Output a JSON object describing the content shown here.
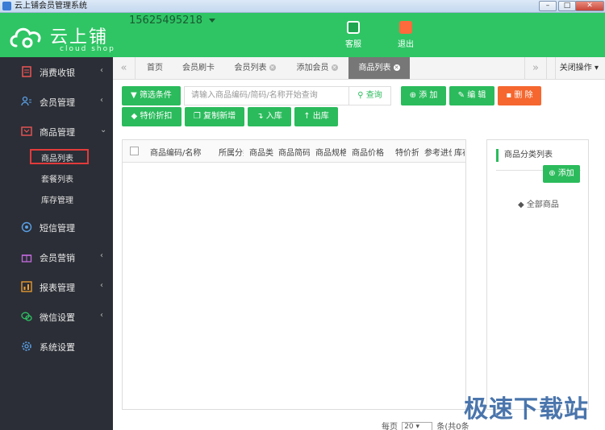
{
  "window": {
    "title": "云上铺会员管理系统"
  },
  "header": {
    "logo_name": "云上铺",
    "logo_sub": "cloud shop",
    "phone": "15625495218",
    "service_label": "客服",
    "exit_label": "退出",
    "brand_color": "#2fc565"
  },
  "sidebar": {
    "items": [
      {
        "label": "消费收银",
        "icon": "cashier-icon"
      },
      {
        "label": "会员管理",
        "icon": "members-icon"
      },
      {
        "label": "商品管理",
        "icon": "goods-icon"
      },
      {
        "label": "短信管理",
        "icon": "sms-icon"
      },
      {
        "label": "会员营销",
        "icon": "gift-icon"
      },
      {
        "label": "报表管理",
        "icon": "report-icon"
      },
      {
        "label": "微信设置",
        "icon": "wechat-icon"
      },
      {
        "label": "系统设置",
        "icon": "gear-icon"
      }
    ],
    "sub_items": [
      {
        "label": "商品列表"
      },
      {
        "label": "套餐列表"
      },
      {
        "label": "库存管理"
      }
    ]
  },
  "tabs": {
    "items": [
      {
        "label": "首页"
      },
      {
        "label": "会员刷卡"
      },
      {
        "label": "会员列表"
      },
      {
        "label": "添加会员"
      },
      {
        "label": "商品列表"
      }
    ],
    "close_ops": "关闭操作"
  },
  "toolbar": {
    "filter": "筛选条件",
    "search_placeholder": "请输入商品编码/简码/名称开始查询",
    "search": "查询",
    "add": "添 加",
    "edit": "编 辑",
    "delete": "删 除",
    "discount": "特价折扣",
    "copy_new": "复制新增",
    "stock_in": "入库",
    "stock_out": "出库"
  },
  "table": {
    "columns": [
      "商品编码/名称",
      "所属分类",
      "商品类型",
      "商品简码",
      "商品规格",
      "商品价格",
      "特价折扣",
      "参考进价",
      "库存"
    ]
  },
  "category": {
    "title": "商品分类列表",
    "add": "添加",
    "all": "全部商品"
  },
  "pager": {
    "prefix": "每页",
    "page_size": "20",
    "suffix": "条(共0条"
  },
  "watermark": "极速下载站"
}
